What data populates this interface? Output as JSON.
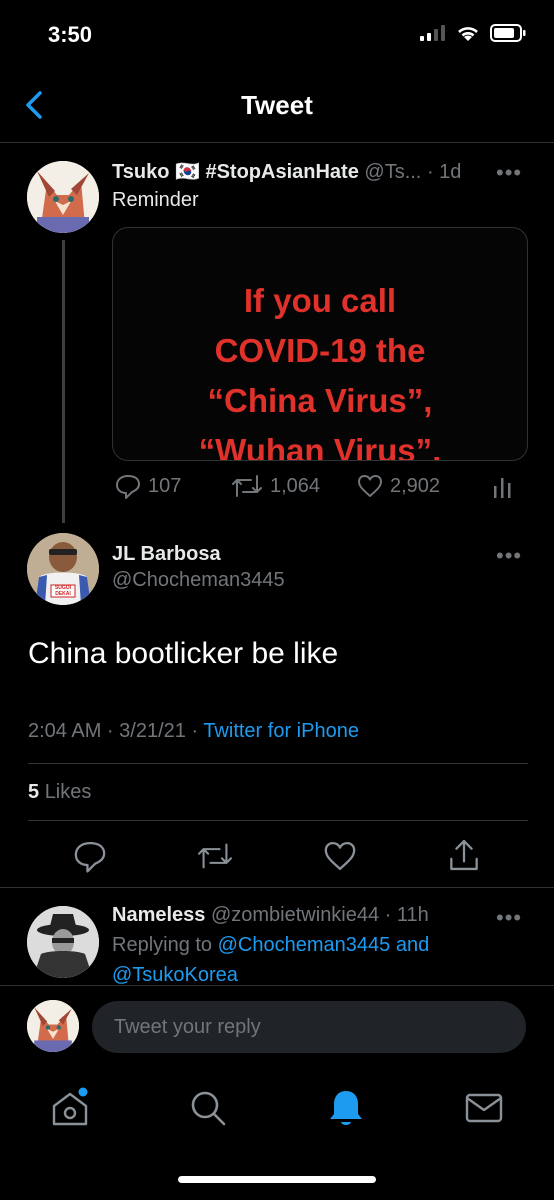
{
  "status": {
    "time": "3:50"
  },
  "header": {
    "title": "Tweet"
  },
  "quoted": {
    "name": "Tsuko",
    "flag": "🇰🇷",
    "hashtag": "#StopAsianHate",
    "handle": "@Ts...",
    "time": "· 1d",
    "text": "Reminder",
    "image_text": [
      "If you call",
      "COVID-19 the",
      "“China Virus”,",
      "“Wuhan Virus”,"
    ],
    "replies": "107",
    "retweets": "1,064",
    "likes": "2,902"
  },
  "main": {
    "name": "JL Barbosa",
    "handle": "@Chocheman3445",
    "shirt_text": "SUGOI DEKAI",
    "text": "China bootlicker be like",
    "timestamp": "2:04 AM · 3/21/21 ·",
    "source": "Twitter for iPhone",
    "likes_count": "5",
    "likes_label": "Likes"
  },
  "reply": {
    "name": "Nameless",
    "handle": "@zombietwinkie44 · 11h",
    "replying_to": "Replying to",
    "mention1": "@Chocheman3445 and",
    "mention2": "@TsukoKorea"
  },
  "composer": {
    "placeholder": "Tweet your reply"
  },
  "colors": {
    "accent": "#1d9bf0",
    "image_text": "#e0312b"
  }
}
